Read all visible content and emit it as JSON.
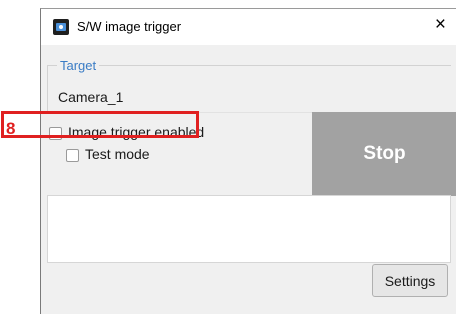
{
  "annotation": {
    "step_number": "8",
    "highlight_color": "#e02020"
  },
  "window": {
    "title": "S/W image trigger",
    "icon": "camera-app-icon",
    "close_glyph": "×"
  },
  "target": {
    "legend": "Target",
    "value": "Camera_1",
    "legend_color": "#3a7cc5"
  },
  "options": {
    "image_trigger_enabled": {
      "label": "Image trigger enabled",
      "checked": false
    },
    "test_mode": {
      "label": "Test mode",
      "checked": false
    }
  },
  "buttons": {
    "stop_label": "Stop",
    "stop_color": "#a2a2a2",
    "settings_label": "Settings"
  },
  "log": {
    "text": ""
  }
}
